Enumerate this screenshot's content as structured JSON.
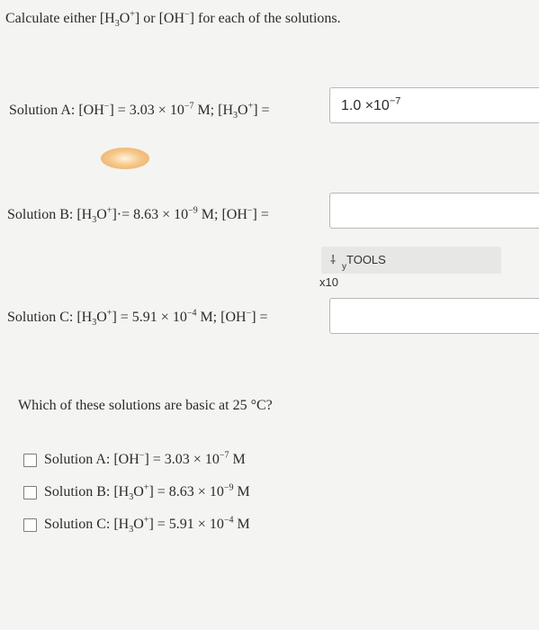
{
  "prompt": {
    "pre": "Calculate either [H",
    "sub": "3",
    "mid": "O",
    "sup": "+",
    "post": "] or [OH",
    "sup2": "−",
    "end": "] for each of the solutions."
  },
  "solutions": {
    "a": {
      "label": "Solution A: [OH",
      "label_sup": "−",
      "label_mid": "] = 3.03 × 10",
      "label_exp": "−7",
      "label_post": " M; [H",
      "label_sub": "3",
      "label_o": "O",
      "label_sup2": "+",
      "label_end": "] =",
      "answer_base": "1.0  ×10",
      "answer_exp": "−7"
    },
    "b": {
      "label": "Solution B: [H",
      "label_sub": "3",
      "label_o": "O",
      "label_sup": "+",
      "label_mid": "]·= 8.63 × 10",
      "label_exp": "−9",
      "label_post": " M; [OH",
      "label_sup2": "−",
      "label_end": "] ="
    },
    "c": {
      "label": "Solution C: [H",
      "label_sub": "3",
      "label_o": "O",
      "label_sup": "+",
      "label_mid": "] = 5.91 × 10",
      "label_exp": "−4",
      "label_post": " M; [OH",
      "label_sup2": "−",
      "label_end": "] ="
    }
  },
  "tools": {
    "label": "TOOLS",
    "x10": "x10",
    "y": "y",
    "icon": "wrench-icon"
  },
  "question2": "Which of these solutions are basic at 25 °C?",
  "options": {
    "a": {
      "pre": "Solution A: [OH",
      "sup": "−",
      "mid": "] = 3.03 × 10",
      "exp": "−7",
      "post": " M"
    },
    "b": {
      "pre": "Solution B: [H",
      "sub": "3",
      "o": "O",
      "sup": "+",
      "mid": "] = 8.63 × 10",
      "exp": "−9",
      "post": " M"
    },
    "c": {
      "pre": "Solution C: [H",
      "sub": "3",
      "o": "O",
      "sup": "+",
      "mid": "] = 5.91 × 10",
      "exp": "−4",
      "post": " M"
    }
  }
}
